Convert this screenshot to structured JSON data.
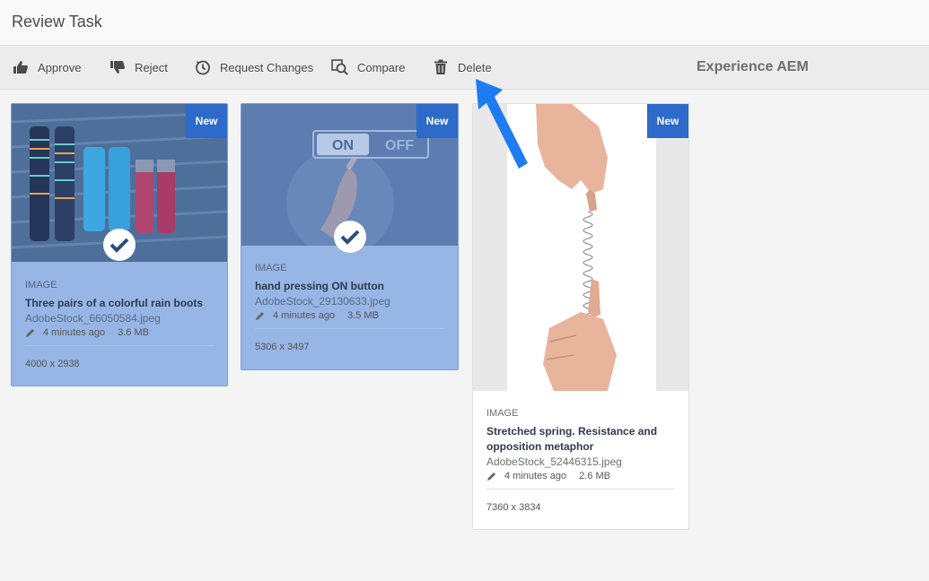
{
  "window": {
    "title": "Review Task"
  },
  "toolbar": {
    "approve_label": "Approve",
    "reject_label": "Reject",
    "request_changes_label": "Request Changes",
    "compare_label": "Compare",
    "delete_label": "Delete",
    "brand": "Experience AEM"
  },
  "colors": {
    "accent": "#2d6ac9",
    "selected_card": "#97b5e5",
    "pointer_arrow": "#1f7cf0"
  },
  "assets": [
    {
      "badge": "New",
      "type": "IMAGE",
      "title": "Three pairs of a colorful rain boots",
      "filename": "AdobeStock_66050584.jpeg",
      "modified": "4 minutes ago",
      "size": "3.6 MB",
      "dimensions": "4000 x 2938",
      "selected": true
    },
    {
      "badge": "New",
      "type": "IMAGE",
      "title": "hand pressing ON button",
      "filename": "AdobeStock_29130633.jpeg",
      "modified": "4 minutes ago",
      "size": "3.5 MB",
      "dimensions": "5306 x 3497",
      "selected": true,
      "thumbnail_text": {
        "on": "ON",
        "off": "OFF"
      }
    },
    {
      "badge": "New",
      "type": "IMAGE",
      "title": "Stretched spring. Resistance and opposition metaphor",
      "filename": "AdobeStock_52446315.jpeg",
      "modified": "4 minutes ago",
      "size": "2.6 MB",
      "dimensions": "7360 x 3834",
      "selected": false
    }
  ]
}
